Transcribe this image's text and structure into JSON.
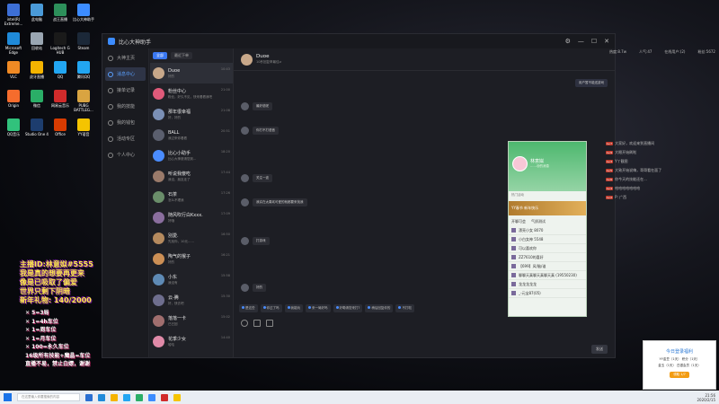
{
  "desktop": {
    "icons": [
      {
        "label": "intel(R) Extreme...",
        "color": "#3d6fd6"
      },
      {
        "label": "此电脑",
        "color": "#4a9ad8"
      },
      {
        "label": "战王直播",
        "color": "#2d8f5a"
      },
      {
        "label": "比心大神助手",
        "color": "#3c8cff"
      },
      {
        "label": "Microsoft Edge",
        "color": "#1f8ad9"
      },
      {
        "label": "回收站",
        "color": "#9aa6b2"
      },
      {
        "label": "Logitech G HUB",
        "color": "#1a1a1a"
      },
      {
        "label": "Steam",
        "color": "#1b2838"
      },
      {
        "label": "VLC",
        "color": "#f08a24"
      },
      {
        "label": "虎牙直播",
        "color": "#f5b400"
      },
      {
        "label": "QQ",
        "color": "#22a6f2"
      },
      {
        "label": "腾讯QQ",
        "color": "#22a6f2"
      },
      {
        "label": "Origin",
        "color": "#f56c2d"
      },
      {
        "label": "微信",
        "color": "#2aae67"
      },
      {
        "label": "网易云音乐",
        "color": "#d12b2b"
      },
      {
        "label": "PUBG BATTLEG...",
        "color": "#d9a441"
      },
      {
        "label": "QQ音乐",
        "color": "#31c27c"
      },
      {
        "label": "Studio One 4",
        "color": "#1d3d6e"
      },
      {
        "label": "Office",
        "color": "#d83b01"
      },
      {
        "label": "YY语音",
        "color": "#f5c400"
      }
    ]
  },
  "promo": {
    "lines_big": [
      "主播ID:林意姒#5555",
      "我是真的想要再更来",
      "像是已吸取了偏爱",
      "世界只剩下阴暗",
      "新年礼物: 140/2000"
    ],
    "lines_small": [
      "✕ 5=3局",
      "✕ 1=4h车位",
      "✕ 1=周车位",
      "✕ 1=月车位",
      "✕ 100=永久车位",
      "16级所有技能+魔晶=车位",
      "直播不易，禁止白嫖，谢谢"
    ]
  },
  "app": {
    "title": "比心大神助手",
    "window_controls": [
      "⚙",
      "—",
      "☐",
      "✕"
    ],
    "sidebar": [
      {
        "label": "大神主页",
        "active": false
      },
      {
        "label": "消息中心",
        "active": true
      },
      {
        "label": "接单记录",
        "active": false
      },
      {
        "label": "我的技能",
        "active": false
      },
      {
        "label": "我的钱包",
        "active": false
      },
      {
        "label": "活动专区",
        "active": false
      },
      {
        "label": "个人中心",
        "active": false
      }
    ],
    "conv_tabs": [
      {
        "label": "全部",
        "active": true
      },
      {
        "label": "最近下单",
        "active": false
      }
    ],
    "conversations": [
      {
        "name": "Duoe",
        "preview": "好的",
        "time": "10:43",
        "color": "#c8a88a",
        "active": true
      },
      {
        "name": "粉丝中心",
        "preview": "粉丝，好久不见，快来看看我吧",
        "time": "21:00",
        "color": "#e05a7a",
        "active": false
      },
      {
        "name": "那年很幸福",
        "preview": "好，好的",
        "time": "21:08",
        "color": "#7a8fb5",
        "active": false
      },
      {
        "name": "BALL",
        "preview": "我过来你看看",
        "time": "20:51",
        "color": "#5b5f6e",
        "active": false
      },
      {
        "name": "比心小助手",
        "preview": "比心大神邀请您到...",
        "time": "18:20",
        "color": "#4a8cff",
        "active": false
      },
      {
        "name": "听说我傻吃",
        "preview": "我没，朋友走了",
        "time": "17:44",
        "color": "#9a7a6a",
        "active": false
      },
      {
        "name": "石茶",
        "preview": "怎么不理我",
        "time": "17:26",
        "color": "#6a8e6a",
        "active": false
      },
      {
        "name": "随风吹行白Kxxx.",
        "preview": "好哦",
        "time": "17:09",
        "color": "#8a6e9e",
        "active": false
      },
      {
        "name": "別愛.",
        "preview": "先找你，10元……",
        "time": "16:50",
        "color": "#b58a5e",
        "active": false
      },
      {
        "name": "陶气的猴子",
        "preview": "好的",
        "time": "16:21",
        "color": "#cc8f55",
        "active": false
      },
      {
        "name": "小东",
        "preview": "我没有",
        "time": "15:58",
        "color": "#5e8ab5",
        "active": false
      },
      {
        "name": "云-腾",
        "preview": "好，快去吧",
        "time": "15:30",
        "color": "#6e6e8e",
        "active": false
      },
      {
        "name": "落落一卡",
        "preview": "已已回",
        "time": "15:02",
        "color": "#a06e6e",
        "active": false
      },
      {
        "name": "花季少女",
        "preview": "哈哈",
        "time": "14:40",
        "color": "#e08aa8",
        "active": false
      }
    ],
    "chat": {
      "name": "Duoe",
      "sub": "10秒回复率最佳≥",
      "messages": [
        {
          "side": "right",
          "text": "用户暂不能送游戏"
        },
        {
          "side": "left",
          "text": "最好说呢"
        },
        {
          "side": "left",
          "text": "你打不打语音"
        },
        {
          "side": "left",
          "text": "关注一波"
        },
        {
          "side": "left",
          "text": "我实在太喜欢可爱的就都要来找我"
        },
        {
          "side": "left",
          "text": "打游戏"
        },
        {
          "side": "left",
          "text": "好的"
        }
      ],
      "quick_replies": [
        "是这些",
        "你过了吗",
        "我能玩",
        "来一局好吗",
        "好嘞请您来打?",
        "稍后回复你的",
        "不打啦"
      ],
      "send_label": "发送"
    }
  },
  "qq_panel": {
    "name": "林意姒",
    "sub": "……@的消息",
    "section": "热门活动",
    "banner": "YY春节 新年快乐",
    "list_head": [
      "开聊可会",
      "气质测试"
    ],
    "rows": [
      "漂亮小女 8070",
      "小白女神 5548",
      "可以喜欢你",
      "ZZ7610的喜好",
      "【699】风/脑/谁",
      "聊聊天真聊天真聊天真 (19550230)",
      "龙龙龙龙龙",
      "_-元宝87(05)"
    ]
  },
  "side_panel": {
    "stats": [
      "热度:8.7w",
      "人气:47",
      "在线用户:(2)",
      "粉丝:5672"
    ],
    "danmu": [
      {
        "badge": "Lv.7",
        "text": "大家好，欢迎来到直播间"
      },
      {
        "badge": "Lv.9",
        "text": "大眼开始刷啦"
      },
      {
        "badge": "Lv.3",
        "text": "Y丫截图"
      },
      {
        "badge": "Lv.5",
        "text": "大致开始说嗨，哥哥看在面了"
      },
      {
        "badge": "Lv.6",
        "text": "你今天的技能还在..."
      },
      {
        "badge": "Lv.4",
        "text": "哈哈哈哈哈哈哈"
      },
      {
        "badge": "Lv.2",
        "text": "P: 广西"
      }
    ]
  },
  "notify": {
    "title": "今日登录福利",
    "lines": [
      "YY金豆（1天）  积分（1天）",
      "金玉（1天）  白银会员（1天）"
    ],
    "button": "领取 1/7"
  },
  "taskbar": {
    "search_placeholder": "在这里输入你要搜索的内容",
    "time": "21:56",
    "date": "2020/2/15"
  }
}
